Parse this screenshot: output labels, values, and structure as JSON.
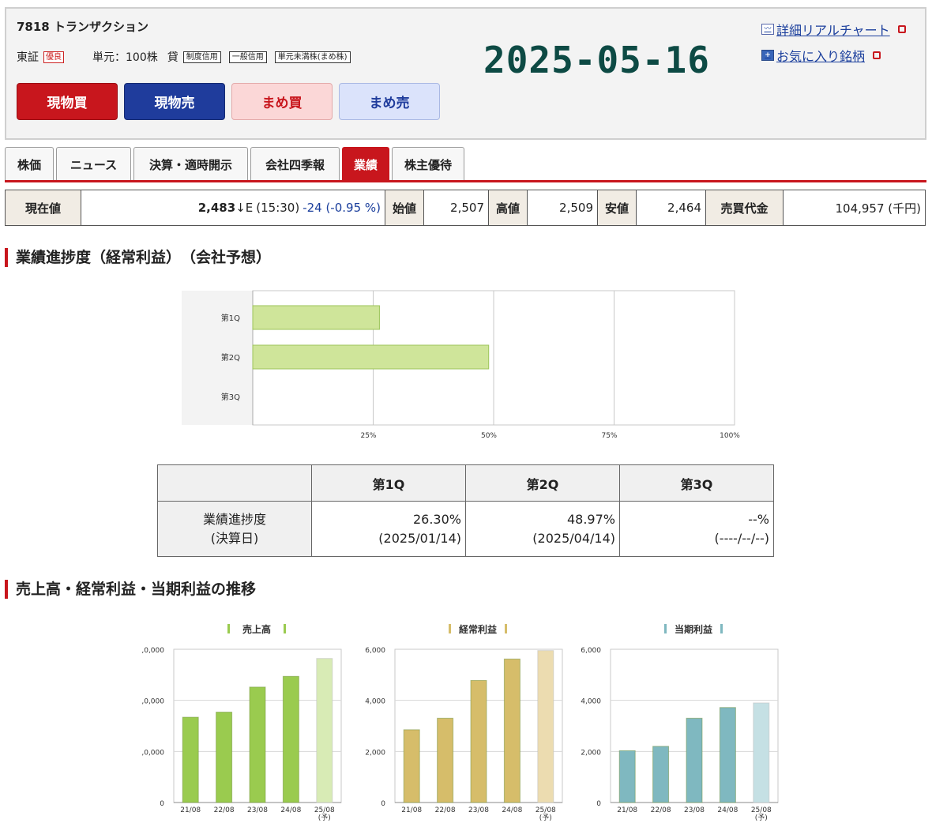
{
  "header": {
    "title": "7818 トランザクション",
    "exchange": "東証",
    "tag_prime": "優良",
    "unit": "単元：100株",
    "lending_label": "貸",
    "tags": [
      "制度信用",
      "一般信用",
      "単元未満株(まめ株)"
    ],
    "date": "2025-05-16",
    "buttons": {
      "buy": "現物買",
      "sell": "現物売",
      "mame_buy": "まめ買",
      "mame_sell": "まめ売"
    },
    "links": {
      "chart": "詳細リアルチャート",
      "favorite": "お気に入り銘柄"
    }
  },
  "tabs": [
    "株価",
    "ニュース",
    "決算・適時開示",
    "会社四季報",
    "業績",
    "株主優待"
  ],
  "price": {
    "current_label": "現在値",
    "current_value": "2,483",
    "arrow": "↓",
    "flag": "E",
    "time": "(15:30)",
    "change": "-24 (-0.95 %)",
    "open_label": "始値",
    "open": "2,507",
    "high_label": "高値",
    "high": "2,509",
    "low_label": "安値",
    "low": "2,464",
    "turnover_label": "売買代金",
    "turnover": "104,957 (千円)"
  },
  "sections": {
    "progress_title": "業績進捗度（経常利益）　（会社予想）",
    "trend_title": "売上高・経常利益・当期利益の推移"
  },
  "progress_table": {
    "columns": [
      "第1Q",
      "第2Q",
      "第3Q"
    ],
    "row_label": [
      "業績進捗度",
      "(決算日)"
    ],
    "values": [
      "26.30%",
      "48.97%",
      "--%"
    ],
    "dates": [
      "(2025/01/14)",
      "(2025/04/14)",
      "(----/--/--)"
    ]
  },
  "chart_data": [
    {
      "type": "bar",
      "orientation": "horizontal",
      "categories": [
        "第1Q",
        "第2Q",
        "第3Q"
      ],
      "values": [
        26.3,
        48.97,
        null
      ],
      "xticks": [
        "25%",
        "50%",
        "75%",
        "100%"
      ],
      "xlim": [
        0,
        100
      ],
      "grid": true,
      "color": "#cfe59a"
    },
    {
      "type": "bar",
      "title": "売上高",
      "categories": [
        "21/08",
        "22/08",
        "23/08",
        "24/08",
        "25/08"
      ],
      "forecast_note": "(予)",
      "values": [
        16700,
        17700,
        22600,
        24700,
        28200
      ],
      "yticks": [
        "0",
        ",0,000",
        ",0,000",
        ",0,000"
      ],
      "ylim": [
        0,
        30000
      ],
      "colors": [
        "#9acb4f",
        "#9acb4f",
        "#9acb4f",
        "#9acb4f",
        "#d8ebb5"
      ]
    },
    {
      "type": "bar",
      "title": "経常利益",
      "categories": [
        "21/08",
        "22/08",
        "23/08",
        "24/08",
        "25/08"
      ],
      "forecast_note": "(予)",
      "values": [
        2850,
        3300,
        4780,
        5620,
        5950
      ],
      "yticks": [
        "0",
        "2,000",
        "4,000",
        "6,000"
      ],
      "ylim": [
        0,
        6000
      ],
      "colors": [
        "#d6bd6a",
        "#d6bd6a",
        "#d6bd6a",
        "#d6bd6a",
        "#ecdcb0"
      ]
    },
    {
      "type": "bar",
      "title": "当期利益",
      "categories": [
        "21/08",
        "22/08",
        "23/08",
        "24/08",
        "25/08"
      ],
      "forecast_note": "(予)",
      "values": [
        2030,
        2200,
        3300,
        3720,
        3900
      ],
      "yticks": [
        "0",
        "2,000",
        "4,000",
        "6,000"
      ],
      "ylim": [
        0,
        6000
      ],
      "colors": [
        "#7fb8c0",
        "#7fb8c0",
        "#7fb8c0",
        "#7fb8c0",
        "#c5e0e4"
      ]
    }
  ]
}
